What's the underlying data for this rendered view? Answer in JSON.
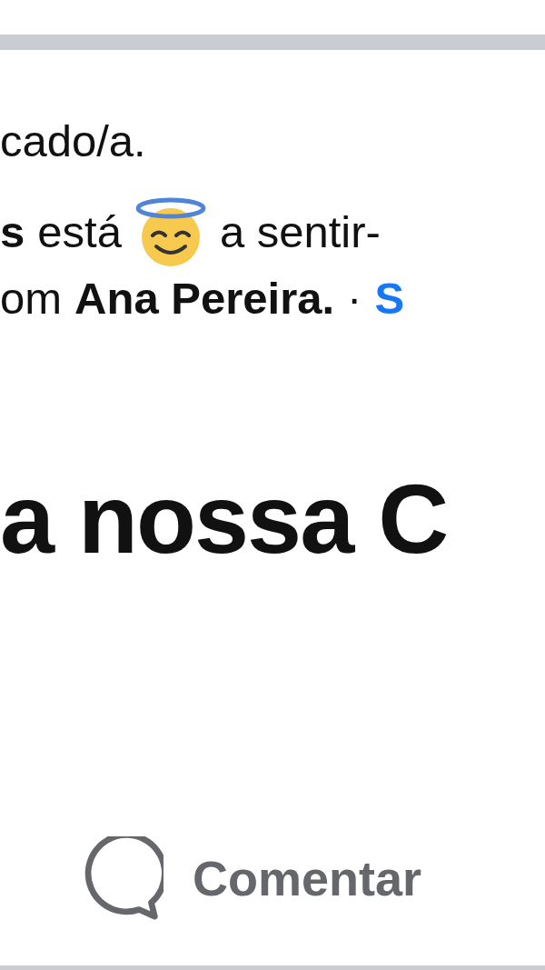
{
  "post": {
    "text_fragment": "cado/a.",
    "status": {
      "author_end": "s",
      "verb": "está",
      "feeling": "a sentir-",
      "line2_start": "om",
      "tagged": "Ana Pereira.",
      "separator": "·",
      "link": "S"
    },
    "headline": "a nossa C"
  },
  "actions": [
    {
      "label": "Comentar",
      "kind": "comment"
    }
  ]
}
